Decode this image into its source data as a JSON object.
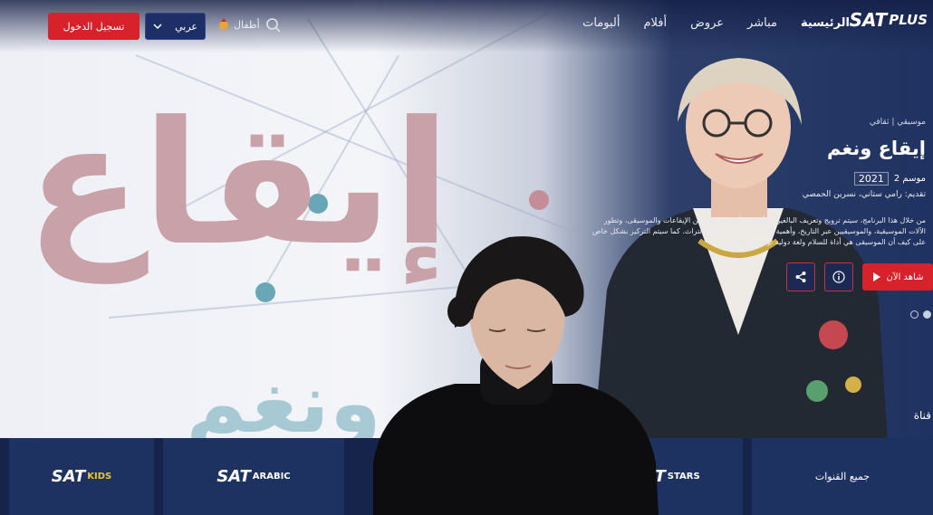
{
  "header": {
    "brand": "SAT",
    "brand_plus": "PLUS",
    "nav": [
      {
        "label": "الرئيسية",
        "active": true
      },
      {
        "label": "مباشر",
        "active": false
      },
      {
        "label": "عروض",
        "active": false
      },
      {
        "label": "أفلام",
        "active": false
      },
      {
        "label": "ألبومات",
        "active": false
      }
    ],
    "kids_label": "أطفال",
    "language": "عربي",
    "login_label": "تسجيل الدخول"
  },
  "hero": {
    "artwork_title": "إيقاع",
    "artwork_subtitle": "ونغم",
    "meta": "موسيقي | ثقافي",
    "title": "إيقاع ونغم",
    "season": "موسم 2",
    "year": "2021",
    "cast": "تقديم: رامي ستاني، نسرين الحمصي",
    "description": "من خلال هذا البرنامج، سيتم ترويج وتعريف البالغين والأطفال بأنواع مختلفة من الإيقاعات والموسيقى، وتطور الآلات الموسيقية، والموسيقيين عبر التاريخ، وأهمية الموسيقى في الثقافة والتراث. كما سيتم التركيز بشكل خاص على كيف أن الموسيقى هي أداة للسلام ولغة دولية توحد كل الناس.",
    "watch_label": "شاهد الآن"
  },
  "channels": {
    "section_label": "قناة",
    "all_channels_label": "جميع القنوات",
    "tiles": [
      {
        "brand": "SAT",
        "sub": "KIDS"
      },
      {
        "brand": "SAT",
        "sub": "ARABIC"
      },
      {
        "brand": "SAT",
        "sub": "STARS"
      }
    ]
  },
  "colors": {
    "accent": "#d7212b",
    "navy": "#1a2c55"
  }
}
